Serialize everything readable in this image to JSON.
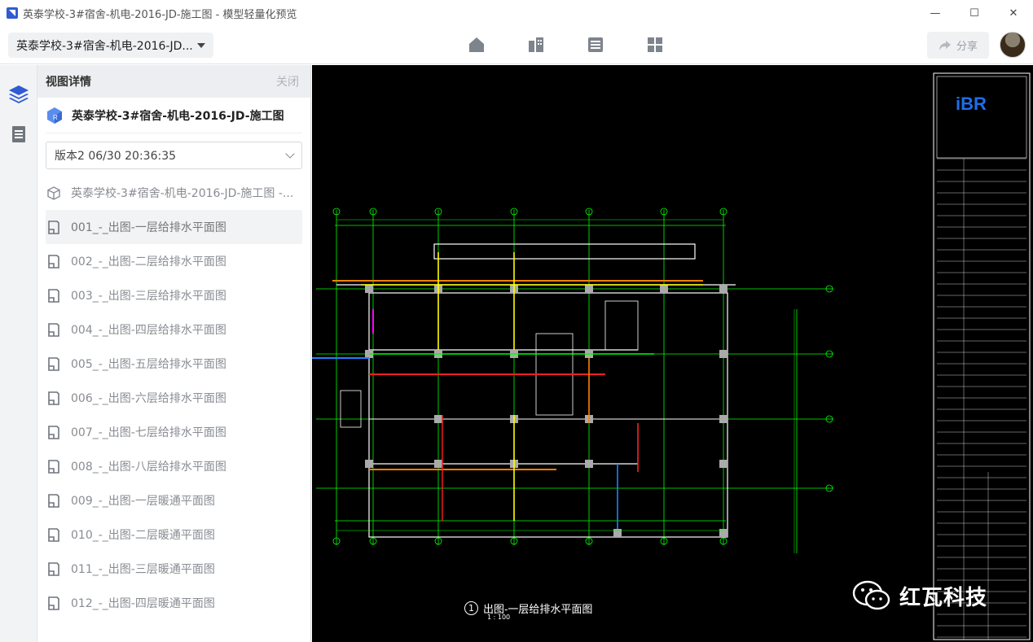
{
  "window": {
    "title": "英泰学校-3#宿舍-机电-2016-JD-施工图 - 模型轻量化预览",
    "minimize": "—",
    "maximize": "☐",
    "close": "✕"
  },
  "toolbar": {
    "project": "英泰学校-3#宿舍-机电-2016-JD...",
    "icons": [
      "home-icon",
      "building-icon",
      "list-icon",
      "grid-icon"
    ],
    "share_label": "分享"
  },
  "panel": {
    "title": "视图详情",
    "close_label": "关闭",
    "model_name": "英泰学校-3#宿舍-机电-2016-JD-施工图",
    "version": "版本2 06/30 20:36:35",
    "items": [
      {
        "label": "英泰学校-3#宿舍-机电-2016-JD-施工图 -...",
        "icon": "cube-icon"
      },
      {
        "label": "001_-_出图-一层给排水平面图",
        "icon": "drawing-icon",
        "active": true
      },
      {
        "label": "002_-_出图-二层给排水平面图",
        "icon": "drawing-icon"
      },
      {
        "label": "003_-_出图-三层给排水平面图",
        "icon": "drawing-icon"
      },
      {
        "label": "004_-_出图-四层给排水平面图",
        "icon": "drawing-icon"
      },
      {
        "label": "005_-_出图-五层给排水平面图",
        "icon": "drawing-icon"
      },
      {
        "label": "006_-_出图-六层给排水平面图",
        "icon": "drawing-icon"
      },
      {
        "label": "007_-_出图-七层给排水平面图",
        "icon": "drawing-icon"
      },
      {
        "label": "008_-_出图-八层给排水平面图",
        "icon": "drawing-icon"
      },
      {
        "label": "009_-_出图-一层暖通平面图",
        "icon": "drawing-icon"
      },
      {
        "label": "010_-_出图-二层暖通平面图",
        "icon": "drawing-icon"
      },
      {
        "label": "011_-_出图-三层暖通平面图",
        "icon": "drawing-icon"
      },
      {
        "label": "012_-_出图-四层暖通平面图",
        "icon": "drawing-icon"
      }
    ]
  },
  "viewer": {
    "drawing_number": "1",
    "drawing_title": "出图-一层给排水平面图",
    "drawing_scale": "1 : 100",
    "watermark": "红瓦科技"
  },
  "colors": {
    "accent": "#2f5bd3",
    "cad_background": "#000000",
    "grid_green": "#00ff00",
    "wall_white": "#ffffff",
    "pipe_orange": "#ff8000",
    "pipe_yellow": "#ffff00",
    "pipe_red": "#ff2020",
    "pipe_blue": "#2080ff",
    "pipe_magenta": "#ff00ff"
  }
}
